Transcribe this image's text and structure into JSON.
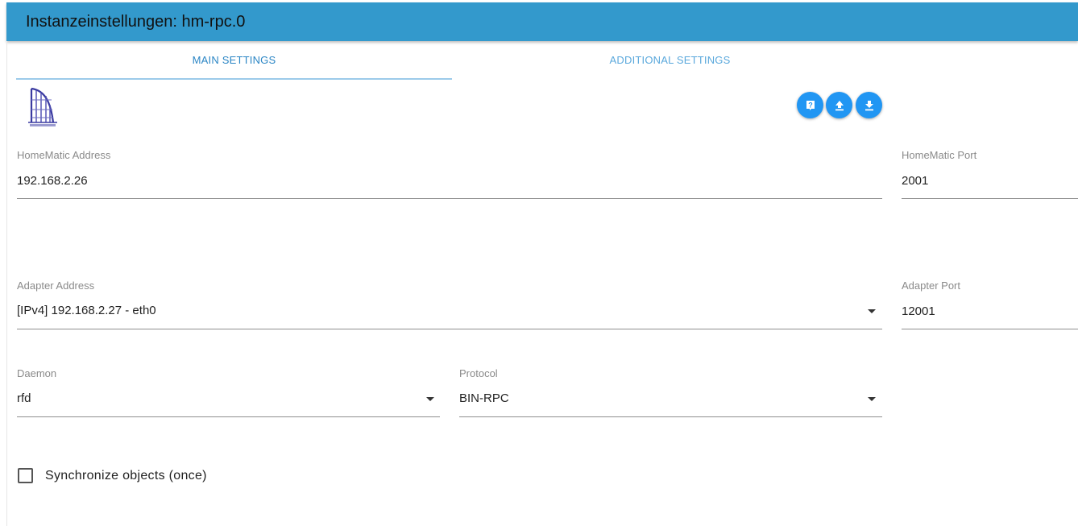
{
  "header": {
    "title": "Instanzeinstellungen: hm-rpc.0"
  },
  "tabs": [
    {
      "label": "MAIN SETTINGS",
      "active": true
    },
    {
      "label": "ADDITIONAL SETTINGS",
      "active": false
    }
  ],
  "toolbar": {
    "buttons": [
      {
        "icon": "help-icon",
        "glyph": "?"
      },
      {
        "icon": "upload-icon"
      },
      {
        "icon": "download-icon"
      }
    ]
  },
  "logo": {
    "icon": "homematic-logo"
  },
  "fields": {
    "homematic_address": {
      "label": "HomeMatic Address",
      "value": "192.168.2.26"
    },
    "homematic_port": {
      "label": "HomeMatic Port",
      "value": "2001"
    },
    "adapter_address": {
      "label": "Adapter Address",
      "value": "[IPv4] 192.168.2.27 - eth0"
    },
    "adapter_port": {
      "label": "Adapter Port",
      "value": "12001"
    },
    "daemon": {
      "label": "Daemon",
      "value": "rfd"
    },
    "protocol": {
      "label": "Protocol",
      "value": "BIN-RPC"
    }
  },
  "sync_objects": {
    "label": "Synchronize objects (once)",
    "checked": false
  },
  "colors": {
    "header_bg": "#3399cc",
    "accent": "#2196f3",
    "tab_text": "#2b86c5"
  }
}
